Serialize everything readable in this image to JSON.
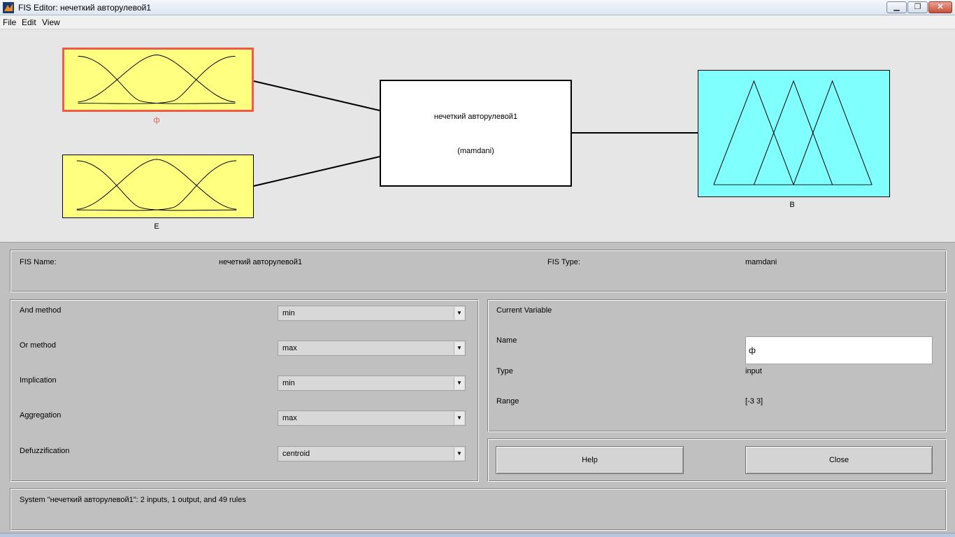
{
  "window": {
    "title": "FIS Editor: нечеткий авторулевой1",
    "min_glyph": "▁",
    "max_glyph": "❐",
    "close_glyph": "✕"
  },
  "menu": {
    "file": "File",
    "edit": "Edit",
    "view": "View"
  },
  "diagram": {
    "inputs": [
      {
        "label": "ф",
        "selected": true
      },
      {
        "label": "E",
        "selected": false
      }
    ],
    "fis_box": {
      "name": "нечеткий авторулевой1",
      "type": "(mamdani)"
    },
    "output": {
      "label": "B"
    }
  },
  "info": {
    "fis_name_label": "FIS Name:",
    "fis_name_value": "нечеткий авторулевой1",
    "fis_type_label": "FIS Type:",
    "fis_type_value": "mamdani"
  },
  "methods": {
    "and": {
      "label": "And method",
      "value": "min"
    },
    "or": {
      "label": "Or method",
      "value": "max"
    },
    "implication": {
      "label": "Implication",
      "value": "min"
    },
    "aggregation": {
      "label": "Aggregation",
      "value": "max"
    },
    "defuzz": {
      "label": "Defuzzification",
      "value": "centroid"
    }
  },
  "current_variable": {
    "title": "Current Variable",
    "name_label": "Name",
    "name_value": "ф",
    "type_label": "Type",
    "type_value": "input",
    "range_label": "Range",
    "range_value": "[-3 3]"
  },
  "buttons": {
    "help": "Help",
    "close": "Close"
  },
  "status": "System \"нечеткий авторулевой1\": 2 inputs, 1 output, and 49 rules",
  "colors": {
    "input_fill": "#ffff80",
    "selected_border": "#f05a4a",
    "output_fill": "#80ffff",
    "panel_bg": "#c0c0c0",
    "diagram_bg": "#e6e6e6"
  }
}
